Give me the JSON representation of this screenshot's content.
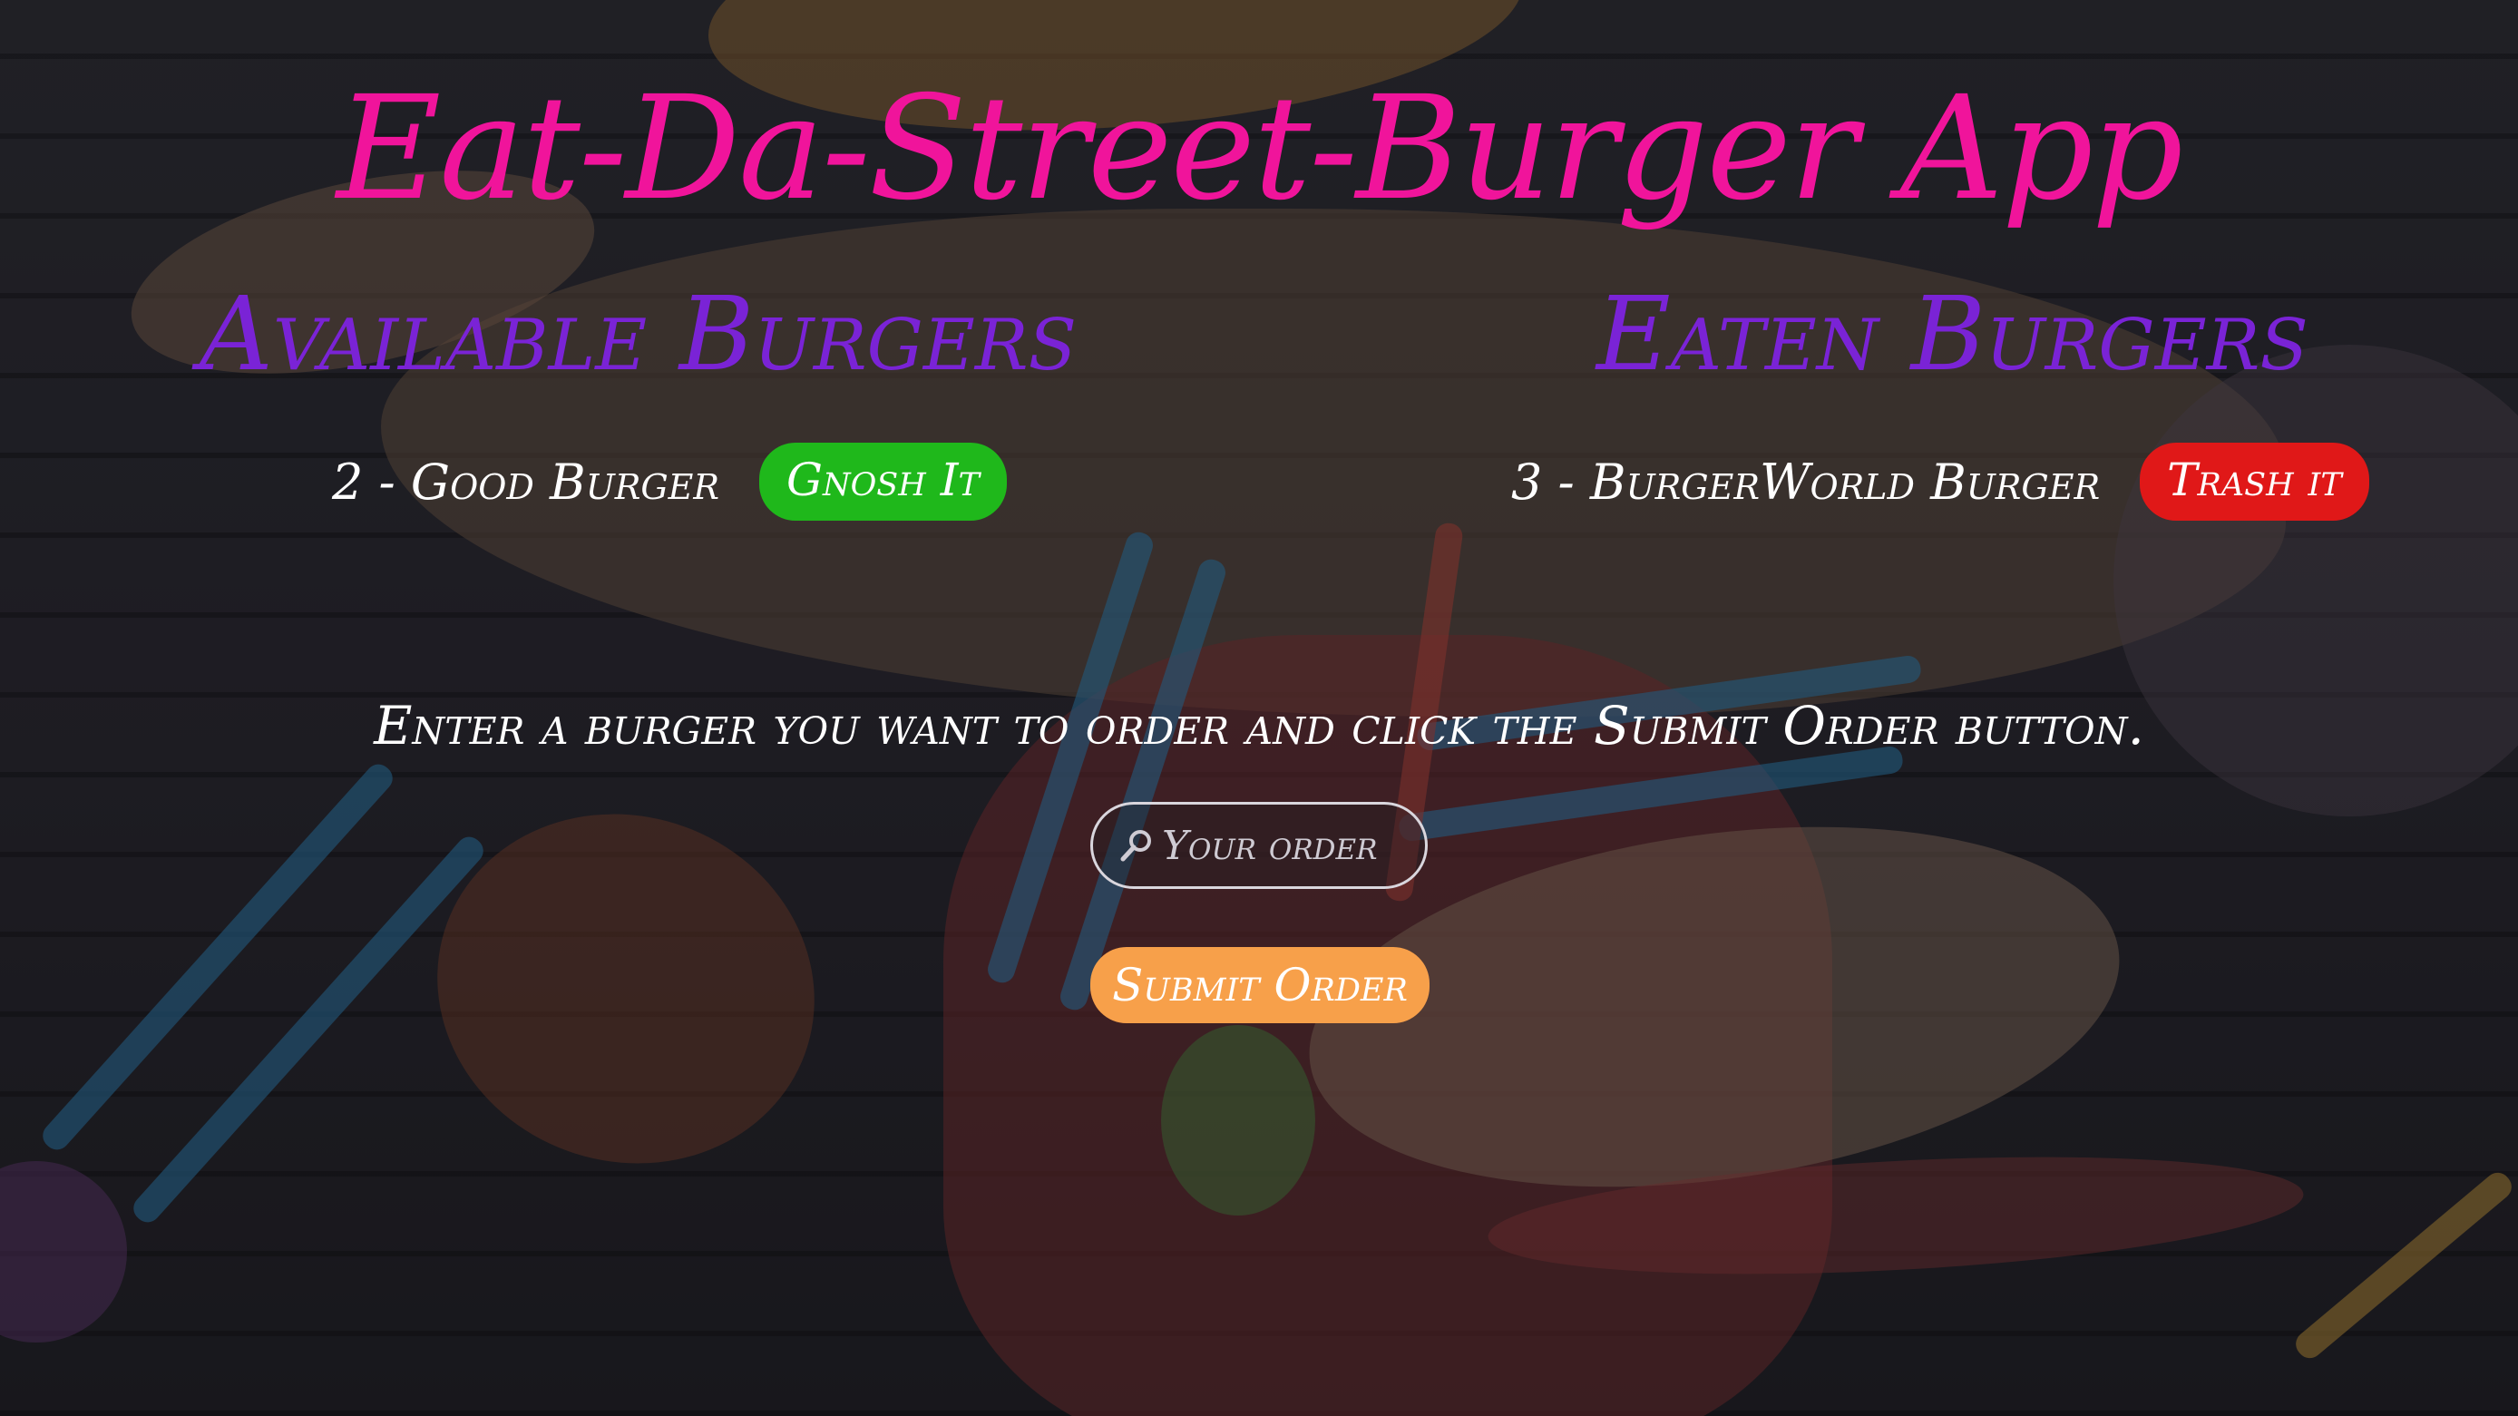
{
  "app": {
    "title": "Eat-Da-Street-Burger App"
  },
  "available": {
    "heading": "Available Burgers",
    "items": [
      {
        "label": "2 - Good Burger",
        "action_label": "Gnosh It"
      }
    ]
  },
  "eaten": {
    "heading": "Eaten Burgers",
    "items": [
      {
        "label": "3 - BurgerWorld Burger",
        "action_label": "Trash it"
      }
    ]
  },
  "order": {
    "instructions": "Enter a burger you want to order and click the Submit Order button.",
    "input_placeholder": "Your order",
    "input_value": "",
    "submit_label": "Submit Order"
  },
  "colors": {
    "title": "#f0149b",
    "section_heading": "#7a23d6",
    "gnosh_button": "#1fb81b",
    "trash_button": "#e01818",
    "submit_button": "#f7a04a"
  },
  "icons": {
    "order_input_icon": "search-icon"
  }
}
